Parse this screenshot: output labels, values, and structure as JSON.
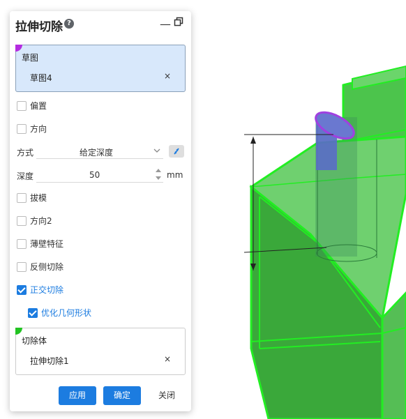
{
  "dialog": {
    "title": "拉伸切除",
    "help_glyph": "?",
    "minimize_glyph": "—"
  },
  "sketch_section": {
    "title": "草图",
    "item": "草图4",
    "remove_glyph": "×",
    "marker_color": "#b42ce0"
  },
  "options": {
    "offset": {
      "label": "偏置",
      "checked": false
    },
    "direction": {
      "label": "方向",
      "checked": false
    }
  },
  "method": {
    "label": "方式",
    "value": "给定深度"
  },
  "depth": {
    "label": "深度",
    "value": "50",
    "unit": "mm"
  },
  "checks": {
    "draft": {
      "label": "拔模",
      "checked": false
    },
    "direction2": {
      "label": "方向2",
      "checked": false
    },
    "thin_feature": {
      "label": "薄壁特征",
      "checked": false
    },
    "reverse_cut": {
      "label": "反侧切除",
      "checked": false
    },
    "orthogonal_cut": {
      "label": "正交切除",
      "checked": true
    },
    "optimize_geometry": {
      "label": "优化几何形状",
      "checked": true
    }
  },
  "cut_body_section": {
    "title": "切除体",
    "item": "拉伸切除1",
    "remove_glyph": "×",
    "marker_color": "#22c322"
  },
  "buttons": {
    "apply": "应用",
    "ok": "确定",
    "close": "关闭"
  },
  "colors": {
    "accent": "#1c7ce0",
    "model_green": "#22dd22",
    "cut_profile": "#a040e0"
  }
}
